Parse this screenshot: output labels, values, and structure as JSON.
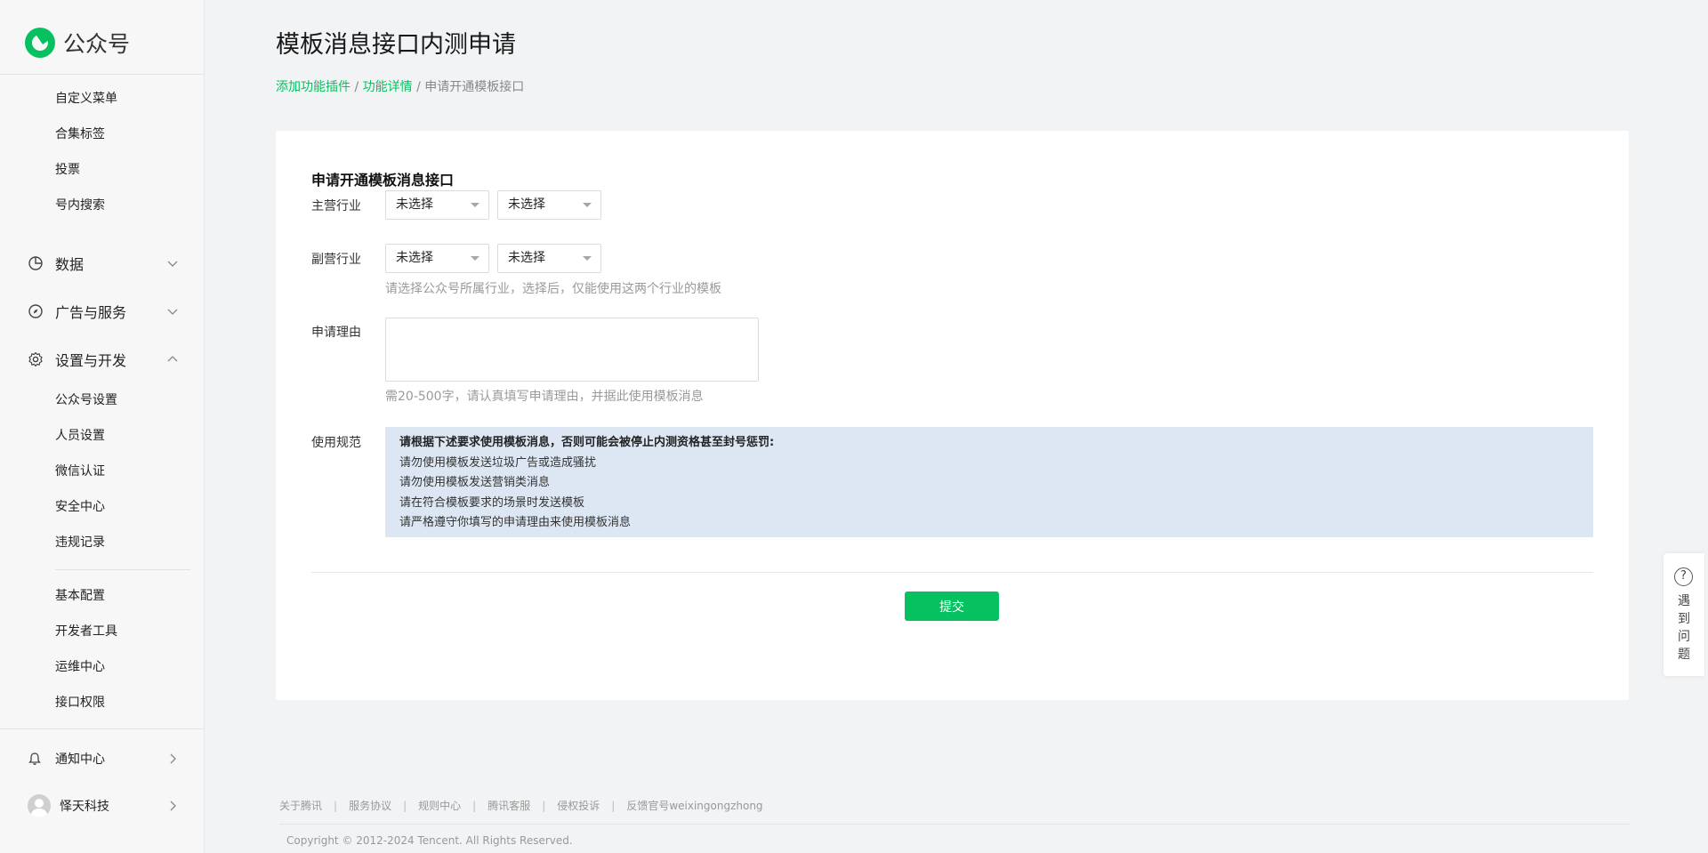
{
  "brand": {
    "name": "公众号"
  },
  "sidebar": {
    "top_items": [
      {
        "label": "自定义菜单"
      },
      {
        "label": "合集标签"
      },
      {
        "label": "投票"
      },
      {
        "label": "号内搜索"
      }
    ],
    "groups": [
      {
        "label": "数据",
        "icon": "pie-chart-icon",
        "expanded": false
      },
      {
        "label": "广告与服务",
        "icon": "compass-icon",
        "expanded": false
      },
      {
        "label": "设置与开发",
        "icon": "gear-icon",
        "expanded": true
      }
    ],
    "settings_items": [
      {
        "label": "公众号设置"
      },
      {
        "label": "人员设置"
      },
      {
        "label": "微信认证"
      },
      {
        "label": "安全中心"
      },
      {
        "label": "违规记录"
      }
    ],
    "dev_items": [
      {
        "label": "基本配置"
      },
      {
        "label": "开发者工具"
      },
      {
        "label": "运维中心"
      },
      {
        "label": "接口权限"
      }
    ],
    "bottom": {
      "notifications": "通知中心",
      "account": "怿天科技"
    }
  },
  "page": {
    "title": "模板消息接口内测申请",
    "breadcrumb": {
      "crumb1": "添加功能插件",
      "crumb2": "功能详情",
      "current": "申请开通模板接口",
      "separator": "/"
    }
  },
  "form": {
    "section_title": "申请开通模板消息接口",
    "main_industry": {
      "label": "主营行业",
      "select1": "未选择",
      "select2": "未选择"
    },
    "sub_industry": {
      "label": "副营行业",
      "select1": "未选择",
      "select2": "未选择"
    },
    "industry_hint": "请选择公众号所属行业，选择后，仅能使用这两个行业的模板",
    "reason": {
      "label": "申请理由",
      "value": "",
      "hint": "需20-500字，请认真填写申请理由，并据此使用模板消息"
    },
    "rules": {
      "label": "使用规范",
      "heading": "请根据下述要求使用模板消息，否则可能会被停止内测资格甚至封号惩罚:",
      "items": [
        "请勿使用模板发送垃圾广告或造成骚扰",
        "请勿使用模板发送营销类消息",
        "请在符合模板要求的场景时发送模板",
        "请严格遵守你填写的申请理由来使用模板消息"
      ]
    },
    "submit_label": "提交"
  },
  "help_widget": {
    "label": "遇到问题",
    "icon": "question-circle-icon"
  },
  "footer": {
    "links": [
      "关于腾讯",
      "服务协议",
      "规则中心",
      "腾讯客服",
      "侵权投诉",
      "反馈官号weixingongzhong"
    ],
    "separator": "|",
    "copyright": "Copyright © 2012-2024 Tencent. All Rights Reserved."
  },
  "colors": {
    "accent": "#07c160",
    "rules_bg": "#dde7f3",
    "page_bg": "#f2f3f5"
  }
}
